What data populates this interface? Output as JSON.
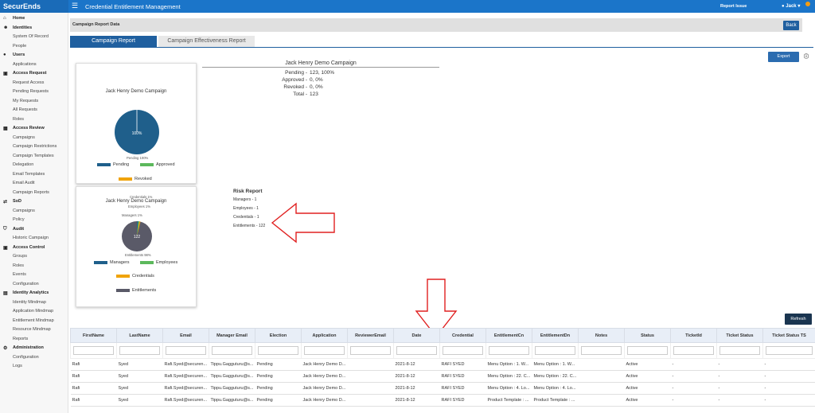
{
  "topbar": {
    "brand": "SecurEnds",
    "menu_icon": "hamburger-icon",
    "title": "Credential Entitlement Management",
    "report_issue": "Report Issue",
    "user": "Jack",
    "colors": {
      "bar": "#1b75c9",
      "badge": "#f39c12"
    }
  },
  "sidebar": {
    "sections": [
      {
        "icon": "home-icon",
        "label": "Home",
        "items": []
      },
      {
        "icon": "users-icon",
        "label": "Identities",
        "items": [
          "System Of Record",
          "People"
        ]
      },
      {
        "icon": "user-icon",
        "label": "Users",
        "items": [
          "Applications"
        ]
      },
      {
        "icon": "lock-icon",
        "label": "Access Request",
        "items": [
          "Request Access",
          "Pending Requests",
          "My Requests",
          "All Requests",
          "Roles"
        ]
      },
      {
        "icon": "grid-icon",
        "label": "Access Review",
        "items": [
          "Campaigns",
          "Campaign Restrictions",
          "Campaign Templates",
          "Delegation",
          "Email Templates",
          "Email Audit",
          "Campaign Reports"
        ]
      },
      {
        "icon": "shuffle-icon",
        "label": "SoD",
        "items": [
          "Campaigns",
          "Policy"
        ]
      },
      {
        "icon": "shield-icon",
        "label": "Audit",
        "items": [
          "Historic Campaign"
        ]
      },
      {
        "icon": "lock-icon",
        "label": "Access Control",
        "items": [
          "Groups",
          "Roles",
          "Events",
          "Configuration"
        ]
      },
      {
        "icon": "chart-icon",
        "label": "Identity Analytics",
        "items": [
          "Identity Mindmap",
          "Application Mindmap",
          "Entitlement Mindmap",
          "Resource Mindmap",
          "Reports"
        ]
      },
      {
        "icon": "admin-icon",
        "label": "Administration",
        "items": [
          "Configuration",
          "Logs"
        ]
      }
    ]
  },
  "page": {
    "breadcrumb": "Campaign Report Data",
    "back": "Back",
    "tabs": [
      "Campaign Report",
      "Campaign Effectiveness Report"
    ],
    "export": "Export",
    "info_icon": "info-icon",
    "refresh": "Refresh"
  },
  "card1": {
    "title": "Jack Henry Demo Campaign",
    "slice_label": "100%",
    "callout": "Pending 100%",
    "legend": [
      {
        "label": "Pending",
        "color": "#1f5f8b"
      },
      {
        "label": "Approved",
        "color": "#5cb85c"
      },
      {
        "label": "Revoked",
        "color": "#f0a30a"
      }
    ]
  },
  "card2": {
    "title": "Jack Henry Demo Campaign",
    "slice_label": "122",
    "callouts": [
      "Credentials 1%",
      "Employees 1%",
      "Managers 1%",
      "Entitlements 98%"
    ],
    "legend": [
      {
        "label": "Managers",
        "color": "#1f5f8b"
      },
      {
        "label": "Employees",
        "color": "#5cb85c"
      },
      {
        "label": "Credentials",
        "color": "#f0a30a"
      },
      {
        "label": "Entitlements",
        "color": "#5a5a68"
      }
    ]
  },
  "stats": {
    "title": "Jack Henry Demo Campaign",
    "rows": [
      {
        "k": "Pending -",
        "v": "123, 100%"
      },
      {
        "k": "Approved -",
        "v": "0, 0%"
      },
      {
        "k": "Revoked -",
        "v": "0, 0%"
      },
      {
        "k": "Total -",
        "v": "123"
      }
    ]
  },
  "risk": {
    "title": "Risk Report",
    "items": [
      "Managers - 1",
      "Employees - 1",
      "Credentials - 1",
      "Entitlements - 122"
    ]
  },
  "chart_data": [
    {
      "type": "pie",
      "title": "Jack Henry Demo Campaign",
      "slices": [
        {
          "label": "Pending",
          "value": 100
        },
        {
          "label": "Approved",
          "value": 0
        },
        {
          "label": "Revoked",
          "value": 0
        }
      ]
    },
    {
      "type": "pie",
      "title": "Jack Henry Demo Campaign",
      "slices": [
        {
          "label": "Managers",
          "value": 1
        },
        {
          "label": "Employees",
          "value": 1
        },
        {
          "label": "Credentials",
          "value": 1
        },
        {
          "label": "Entitlements",
          "value": 122
        }
      ]
    }
  ],
  "table": {
    "columns": [
      "FirstName",
      "LastName",
      "Email",
      "Manager Email",
      "Election",
      "Application",
      "ReviewerEmail",
      "Date",
      "Credential",
      "EntitlementCn",
      "EntitlementDn",
      "Notes",
      "Status",
      "TicketId",
      "Ticket Status",
      "Ticket Status TS"
    ],
    "rows": [
      [
        "Rafi",
        "Syed",
        "Rafi.Syed@securen...",
        "Tippu.Gagguturu@s...",
        "Pending",
        "Jack Henry Demo D...",
        "",
        "2021-8-12",
        "RAFI SYED",
        "Menu Option : 1. W...",
        "Menu Option : 1. W...",
        "",
        "Active",
        "-",
        "-",
        "-"
      ],
      [
        "Rafi",
        "Syed",
        "Rafi.Syed@securen...",
        "Tippu.Gagguturu@s...",
        "Pending",
        "Jack Henry Demo D...",
        "",
        "2021-8-12",
        "RAFI SYED",
        "Menu Option : 22. C...",
        "Menu Option : 22. C...",
        "",
        "Active",
        "-",
        "-",
        "-"
      ],
      [
        "Rafi",
        "Syed",
        "Rafi.Syed@securen...",
        "Tippu.Gagguturu@s...",
        "Pending",
        "Jack Henry Demo D...",
        "",
        "2021-8-12",
        "RAFI SYED",
        "Menu Option : 4. Lo...",
        "Menu Option : 4. Lo...",
        "",
        "Active",
        "-",
        "-",
        "-"
      ],
      [
        "Rafi",
        "Syed",
        "Rafi.Syed@securen...",
        "Tippu.Gagguturu@s...",
        "Pending",
        "Jack Henry Demo D...",
        "",
        "2021-8-12",
        "RAFI SYED",
        "Product Template : ...",
        "Product Template : ...",
        "",
        "Active",
        "-",
        "-",
        "-"
      ]
    ]
  }
}
